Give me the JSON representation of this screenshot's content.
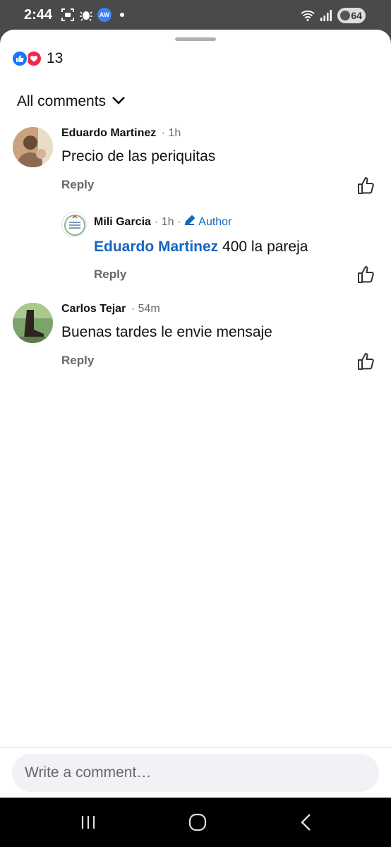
{
  "status_bar": {
    "time": "2:44",
    "aw_badge": "AW",
    "battery": "64",
    "icons": [
      "screenshot-icon",
      "bug-icon",
      "aw-app-icon",
      "notification-dot",
      "wifi-icon",
      "signal-icon",
      "battery-icon"
    ]
  },
  "reactions": {
    "count": "13",
    "types": [
      "like",
      "love"
    ],
    "like_color": "#1877f2",
    "love_color": "#f02849"
  },
  "filter": {
    "label": "All comments"
  },
  "comments": [
    {
      "name": "Eduardo Martinez",
      "time": "· 1h",
      "text": "Precio de las periquitas",
      "reply_label": "Reply",
      "replies": [
        {
          "name": "Mili Garcia",
          "time": "· 1h ·",
          "author_label": "Author",
          "mention": "Eduardo Martinez",
          "text": " 400 la pareja",
          "reply_label": "Reply"
        }
      ]
    },
    {
      "name": "Carlos Tejar",
      "time": "· 54m",
      "text": "Buenas tardes le envie mensaje",
      "reply_label": "Reply"
    }
  ],
  "composer": {
    "placeholder": "Write a comment…"
  },
  "colors": {
    "link_blue": "#1565c0",
    "secondary_text": "#65676b",
    "composer_bg": "#f0f2f5"
  }
}
